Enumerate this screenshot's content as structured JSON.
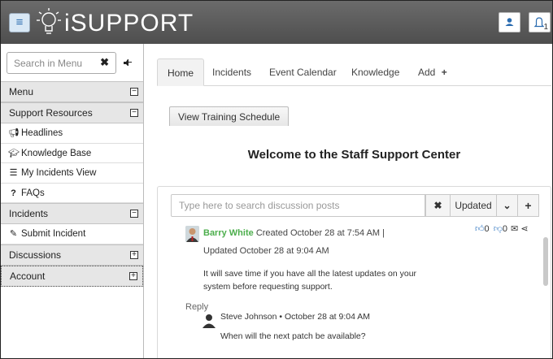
{
  "header": {
    "logo_text": "iSUPPORT",
    "notification_count": "1"
  },
  "sidebar": {
    "search_placeholder": "Search in Menu",
    "sections": [
      {
        "label": "Menu",
        "toggle": "⊟"
      },
      {
        "label": "Support Resources",
        "toggle": "⊟"
      },
      {
        "label": "Incidents",
        "toggle": "⊟"
      },
      {
        "label": "Discussions",
        "toggle": "⊞"
      },
      {
        "label": "Account",
        "toggle": "⊞"
      }
    ],
    "resources_items": [
      {
        "label": "Headlines",
        "icon": "megaphone-icon"
      },
      {
        "label": "Knowledge Base",
        "icon": "graduation-cap-icon"
      },
      {
        "label": "My Incidents View",
        "icon": "list-icon"
      },
      {
        "label": "FAQs",
        "icon": "question-icon"
      }
    ],
    "incidents_items": [
      {
        "label": "Submit Incident",
        "icon": "edit-icon"
      }
    ]
  },
  "tabs": [
    {
      "label": "Home"
    },
    {
      "label": "Incidents"
    },
    {
      "label": "Event Calendar"
    },
    {
      "label": "Knowledge"
    },
    {
      "label": "Add"
    }
  ],
  "main": {
    "training_button": "View Training Schedule",
    "welcome_title": "Welcome to the Staff Support Center"
  },
  "discussion": {
    "search_placeholder": "Type here to search discussion posts",
    "sort_label": "Updated",
    "post": {
      "author": "Barry White",
      "created": "Created October 28 at 7:54 AM |",
      "updated": "Updated October 28 at 9:04 AM",
      "body_line1": "It will save time if you have all the latest updates on your",
      "body_line2": "system before requesting support.",
      "likes": "0",
      "dislikes": "0"
    },
    "reply_label": "Reply",
    "reply": {
      "meta": "Steve Johnson • October 28 at 9:04 AM",
      "body": "When will the next patch be available?"
    }
  }
}
